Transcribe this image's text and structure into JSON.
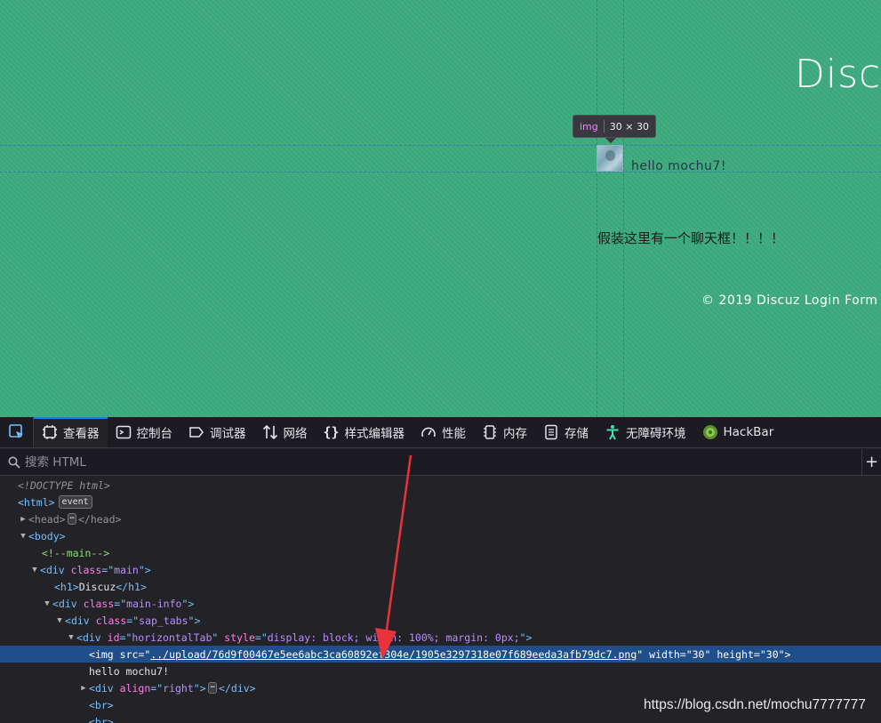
{
  "page": {
    "title": "Discuz",
    "tooltip": {
      "tag": "img",
      "dims": "30 × 30"
    },
    "hello_text": "hello mochu7!",
    "chat_placeholder": "假装这里有一个聊天框！！！！",
    "footer": "© 2019 Discuz Login Form ."
  },
  "devtools": {
    "tabs": [
      {
        "label": "查看器",
        "icon": "inspector-icon",
        "active": true
      },
      {
        "label": "控制台",
        "icon": "console-icon"
      },
      {
        "label": "调试器",
        "icon": "debugger-icon"
      },
      {
        "label": "网络",
        "icon": "network-icon"
      },
      {
        "label": "样式编辑器",
        "icon": "style-editor-icon"
      },
      {
        "label": "性能",
        "icon": "performance-icon"
      },
      {
        "label": "内存",
        "icon": "memory-icon"
      },
      {
        "label": "存储",
        "icon": "storage-icon"
      },
      {
        "label": "无障碍环境",
        "icon": "accessibility-icon"
      },
      {
        "label": "HackBar",
        "icon": "hackbar-icon"
      }
    ],
    "search_placeholder": "搜索 HTML",
    "tree": {
      "doctype": "<!DOCTYPE html>",
      "html_open": "<html>",
      "event_badge": "event",
      "head_open": "<head>",
      "head_close": "</head>",
      "ellipsis": "⋯",
      "body_open": "<body>",
      "comment": "<!--main-->",
      "div_main": {
        "tag": "div",
        "attr": "class",
        "value": "main"
      },
      "h1": {
        "open": "<h1>",
        "text": "Discuz",
        "close": "</h1>"
      },
      "div_main_info": {
        "tag": "div",
        "attr": "class",
        "value": "main-info"
      },
      "div_sap_tabs": {
        "tag": "div",
        "attr": "class",
        "value": "sap_tabs"
      },
      "div_horizontal": {
        "tag": "div",
        "attr1": "id",
        "value1": "horizontalTab",
        "attr2": "style",
        "value2": "display: block; width: 100%; margin: 0px;"
      },
      "img": {
        "tag": "img",
        "attr_src": "src",
        "src": "../upload/76d9f00467e5ee6abc3ca60892ef304e/1905e3297318e07f689eeda3afb79dc7.png",
        "attr_w": "width",
        "w": "30",
        "attr_h": "height",
        "h": "30"
      },
      "text_node": "hello mochu7!",
      "div_align": {
        "tag": "div",
        "attr": "align",
        "value": "right",
        "close": "</div>"
      },
      "br": "<br>"
    }
  },
  "watermark": "https://blog.csdn.net/mochu7777777",
  "colors": {
    "page_bg": "#3dab7e",
    "devtools_bg": "#232327",
    "selection": "#204e8a",
    "accent": "#0a84ff",
    "arrow": "#e8333a"
  }
}
